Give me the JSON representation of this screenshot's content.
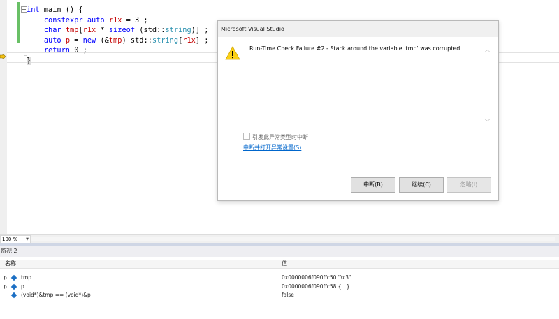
{
  "editor": {
    "lines": [
      [
        {
          "c": "kw",
          "t": "int"
        },
        {
          "c": "",
          "t": " main () {"
        }
      ],
      [
        {
          "c": "",
          "t": "    "
        },
        {
          "c": "kw",
          "t": "constexpr"
        },
        {
          "c": "",
          "t": " "
        },
        {
          "c": "kw",
          "t": "auto"
        },
        {
          "c": "",
          "t": " "
        },
        {
          "c": "var",
          "t": "r1x"
        },
        {
          "c": "",
          "t": " = 3 ;"
        }
      ],
      [
        {
          "c": "",
          "t": "    "
        },
        {
          "c": "kw",
          "t": "char"
        },
        {
          "c": "",
          "t": " "
        },
        {
          "c": "var",
          "t": "tmp"
        },
        {
          "c": "",
          "t": "["
        },
        {
          "c": "var",
          "t": "r1x"
        },
        {
          "c": "",
          "t": " * "
        },
        {
          "c": "kw",
          "t": "sizeof"
        },
        {
          "c": "",
          "t": " (std::"
        },
        {
          "c": "ty",
          "t": "string"
        },
        {
          "c": "",
          "t": ")] ;"
        }
      ],
      [
        {
          "c": "",
          "t": "    "
        },
        {
          "c": "kw",
          "t": "auto"
        },
        {
          "c": "",
          "t": " "
        },
        {
          "c": "var",
          "t": "p"
        },
        {
          "c": "",
          "t": " = "
        },
        {
          "c": "kw",
          "t": "new"
        },
        {
          "c": "",
          "t": " (&"
        },
        {
          "c": "var",
          "t": "tmp"
        },
        {
          "c": "",
          "t": ") std::"
        },
        {
          "c": "ty",
          "t": "string"
        },
        {
          "c": "",
          "t": "["
        },
        {
          "c": "var",
          "t": "r1x"
        },
        {
          "c": "",
          "t": "] ;"
        }
      ],
      [
        {
          "c": "",
          "t": "    "
        },
        {
          "c": "kw",
          "t": "return"
        },
        {
          "c": "",
          "t": " 0 ;"
        }
      ],
      [
        {
          "c": "brace-hl",
          "t": "}"
        }
      ]
    ]
  },
  "zoom": {
    "value": "100 %"
  },
  "watch": {
    "title": "监视 2",
    "col_name": "名称",
    "col_value": "值",
    "rows": [
      {
        "name": "tmp",
        "value": "0x0000006f090ffc50 \"\\x3\"",
        "expandable": true
      },
      {
        "name": "p",
        "value": "0x0000006f090ffc58 {...}",
        "expandable": true
      },
      {
        "name": "(void*)&tmp == (void*)&p",
        "value": "false",
        "expandable": false
      }
    ]
  },
  "dialog": {
    "title": "Microsoft Visual Studio",
    "message": "Run-Time Check Failure #2 - Stack around the variable 'tmp' was corrupted.",
    "checkbox_label": "引发此异常类型时中断",
    "link": "中断并打开异常设置(S)",
    "buttons": {
      "break": "中断(B)",
      "continue": "继续(C)",
      "ignore": "忽略(I)"
    }
  },
  "colors": {
    "keyword": "#0000ff",
    "variable": "#c40000",
    "type": "#2b91af",
    "link": "#0066cc",
    "change_bar": "#69c066"
  }
}
